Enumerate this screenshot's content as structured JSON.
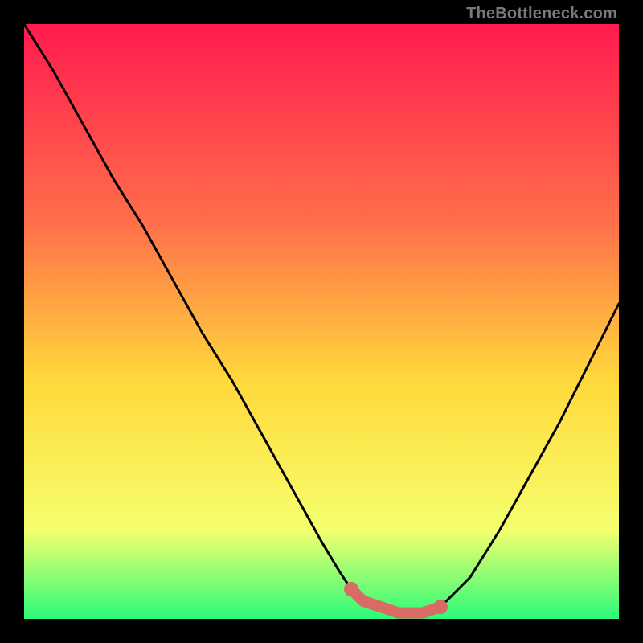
{
  "watermark": {
    "text": "TheBottleneck.com"
  },
  "colors": {
    "gradient_top": "#ff1a4f",
    "gradient_mid1": "#ff6e4a",
    "gradient_mid2": "#ffd93b",
    "gradient_mid3": "#f6ff6e",
    "gradient_bottom": "#2bfb7a",
    "curve": "#000000",
    "highlight": "#d96a64"
  },
  "chart_data": {
    "type": "line",
    "title": "",
    "xlabel": "",
    "ylabel": "",
    "xlim": [
      0,
      100
    ],
    "ylim": [
      0,
      100
    ],
    "grid": false,
    "legend": false,
    "series": [
      {
        "name": "bottleneck-curve",
        "x": [
          0,
          5,
          10,
          15,
          20,
          25,
          30,
          35,
          40,
          45,
          50,
          53,
          55,
          57,
          60,
          63,
          65,
          67,
          70,
          75,
          80,
          85,
          90,
          95,
          100
        ],
        "y": [
          100,
          92,
          83,
          74,
          66,
          57,
          48,
          40,
          31,
          22,
          13,
          8,
          5,
          3,
          2,
          1,
          1,
          1,
          2,
          7,
          15,
          24,
          33,
          43,
          53
        ]
      }
    ],
    "highlight_segment": {
      "name": "optimal-range",
      "x": [
        55,
        57,
        60,
        63,
        65,
        67,
        70
      ],
      "y": [
        5,
        3,
        2,
        1,
        1,
        1,
        2
      ]
    }
  }
}
